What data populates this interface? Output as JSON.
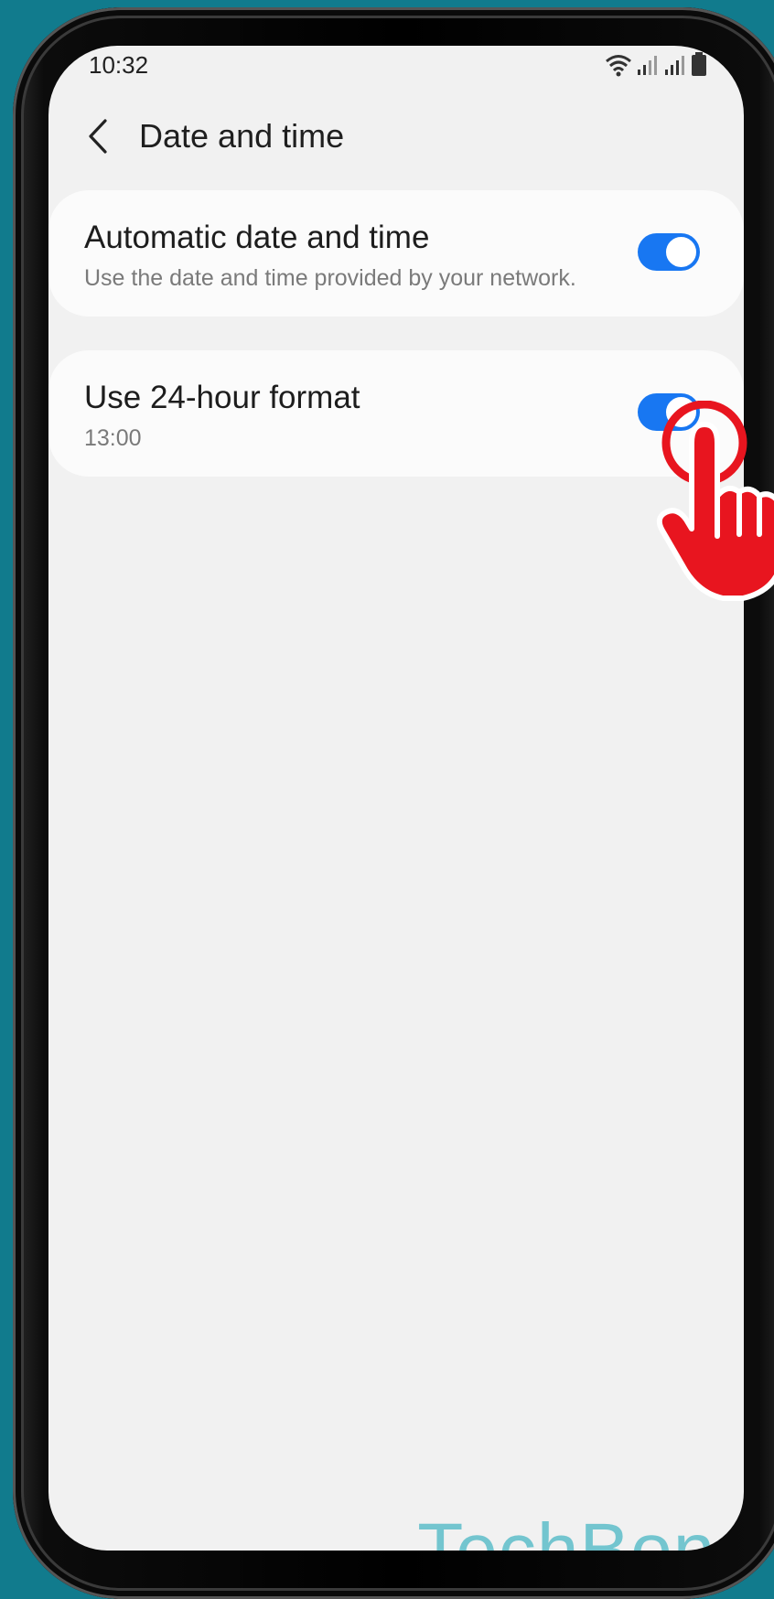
{
  "status_bar": {
    "time": "10:32",
    "icons": [
      "wifi-icon",
      "signal-icon",
      "signal-icon",
      "battery-icon"
    ]
  },
  "app_bar": {
    "back_icon": "chevron-left-icon",
    "title": "Date and time"
  },
  "settings": [
    {
      "title": "Automatic date and time",
      "subtitle": "Use the date and time provided by your network.",
      "toggle_on": true
    },
    {
      "title": "Use 24-hour format",
      "subtitle": "13:00",
      "toggle_on": true
    }
  ],
  "overlay": {
    "icon": "tap-hand-icon"
  },
  "watermark": "TechBone",
  "colors": {
    "accent": "#1877f2",
    "background": "#117b8d",
    "screen": "#f1f1f1",
    "hand": "#e8151f"
  }
}
